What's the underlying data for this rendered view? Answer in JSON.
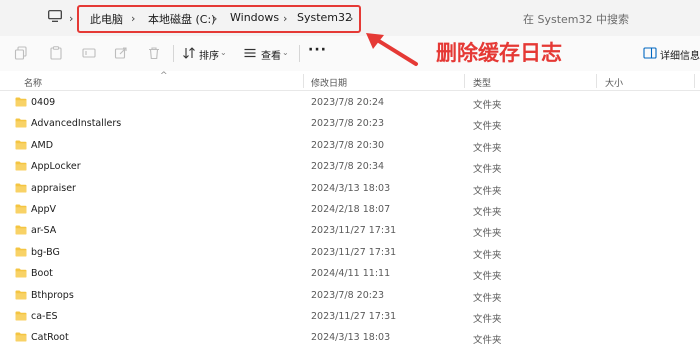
{
  "address_bar": {
    "crumbs": [
      "此电脑",
      "本地磁盘 (C:)",
      "Windows",
      "System32"
    ],
    "search_placeholder": "在 System32 中搜索"
  },
  "toolbar": {
    "sort_label": "排序",
    "view_label": "查看",
    "more_label": "···",
    "details_label": "详细信息"
  },
  "annotation": {
    "text": "删除缓存日志",
    "color": "#e53935"
  },
  "columns": {
    "name": "名称",
    "modified": "修改日期",
    "type": "类型",
    "size": "大小"
  },
  "files": [
    {
      "name": "0409",
      "modified": "2023/7/8 20:24",
      "type": "文件夹"
    },
    {
      "name": "AdvancedInstallers",
      "modified": "2023/7/8 20:23",
      "type": "文件夹"
    },
    {
      "name": "AMD",
      "modified": "2023/7/8 20:30",
      "type": "文件夹"
    },
    {
      "name": "AppLocker",
      "modified": "2023/7/8 20:34",
      "type": "文件夹"
    },
    {
      "name": "appraiser",
      "modified": "2024/3/13 18:03",
      "type": "文件夹"
    },
    {
      "name": "AppV",
      "modified": "2024/2/18 18:07",
      "type": "文件夹"
    },
    {
      "name": "ar-SA",
      "modified": "2023/11/27 17:31",
      "type": "文件夹"
    },
    {
      "name": "bg-BG",
      "modified": "2023/11/27 17:31",
      "type": "文件夹"
    },
    {
      "name": "Boot",
      "modified": "2024/4/11 11:11",
      "type": "文件夹"
    },
    {
      "name": "Bthprops",
      "modified": "2023/7/8 20:23",
      "type": "文件夹"
    },
    {
      "name": "ca-ES",
      "modified": "2023/11/27 17:31",
      "type": "文件夹"
    },
    {
      "name": "CatRoot",
      "modified": "2024/3/13 18:03",
      "type": "文件夹"
    }
  ],
  "colors": {
    "folder": "#f4c542",
    "highlight_border": "#e53935"
  }
}
